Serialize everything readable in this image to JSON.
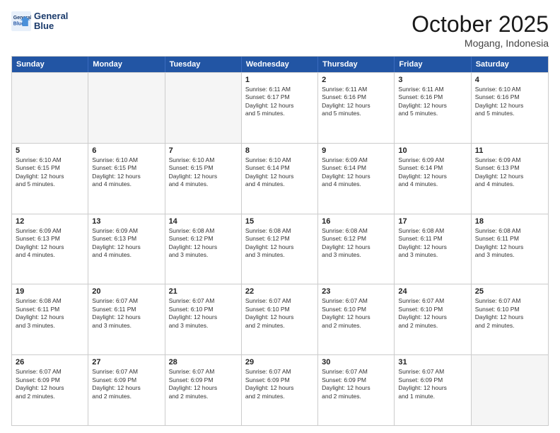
{
  "header": {
    "logo_line1": "General",
    "logo_line2": "Blue",
    "month": "October 2025",
    "location": "Mogang, Indonesia"
  },
  "days_of_week": [
    "Sunday",
    "Monday",
    "Tuesday",
    "Wednesday",
    "Thursday",
    "Friday",
    "Saturday"
  ],
  "rows": [
    [
      {
        "day": "",
        "info": ""
      },
      {
        "day": "",
        "info": ""
      },
      {
        "day": "",
        "info": ""
      },
      {
        "day": "1",
        "info": "Sunrise: 6:11 AM\nSunset: 6:17 PM\nDaylight: 12 hours\nand 5 minutes."
      },
      {
        "day": "2",
        "info": "Sunrise: 6:11 AM\nSunset: 6:16 PM\nDaylight: 12 hours\nand 5 minutes."
      },
      {
        "day": "3",
        "info": "Sunrise: 6:11 AM\nSunset: 6:16 PM\nDaylight: 12 hours\nand 5 minutes."
      },
      {
        "day": "4",
        "info": "Sunrise: 6:10 AM\nSunset: 6:16 PM\nDaylight: 12 hours\nand 5 minutes."
      }
    ],
    [
      {
        "day": "5",
        "info": "Sunrise: 6:10 AM\nSunset: 6:15 PM\nDaylight: 12 hours\nand 5 minutes."
      },
      {
        "day": "6",
        "info": "Sunrise: 6:10 AM\nSunset: 6:15 PM\nDaylight: 12 hours\nand 4 minutes."
      },
      {
        "day": "7",
        "info": "Sunrise: 6:10 AM\nSunset: 6:15 PM\nDaylight: 12 hours\nand 4 minutes."
      },
      {
        "day": "8",
        "info": "Sunrise: 6:10 AM\nSunset: 6:14 PM\nDaylight: 12 hours\nand 4 minutes."
      },
      {
        "day": "9",
        "info": "Sunrise: 6:09 AM\nSunset: 6:14 PM\nDaylight: 12 hours\nand 4 minutes."
      },
      {
        "day": "10",
        "info": "Sunrise: 6:09 AM\nSunset: 6:14 PM\nDaylight: 12 hours\nand 4 minutes."
      },
      {
        "day": "11",
        "info": "Sunrise: 6:09 AM\nSunset: 6:13 PM\nDaylight: 12 hours\nand 4 minutes."
      }
    ],
    [
      {
        "day": "12",
        "info": "Sunrise: 6:09 AM\nSunset: 6:13 PM\nDaylight: 12 hours\nand 4 minutes."
      },
      {
        "day": "13",
        "info": "Sunrise: 6:09 AM\nSunset: 6:13 PM\nDaylight: 12 hours\nand 4 minutes."
      },
      {
        "day": "14",
        "info": "Sunrise: 6:08 AM\nSunset: 6:12 PM\nDaylight: 12 hours\nand 3 minutes."
      },
      {
        "day": "15",
        "info": "Sunrise: 6:08 AM\nSunset: 6:12 PM\nDaylight: 12 hours\nand 3 minutes."
      },
      {
        "day": "16",
        "info": "Sunrise: 6:08 AM\nSunset: 6:12 PM\nDaylight: 12 hours\nand 3 minutes."
      },
      {
        "day": "17",
        "info": "Sunrise: 6:08 AM\nSunset: 6:11 PM\nDaylight: 12 hours\nand 3 minutes."
      },
      {
        "day": "18",
        "info": "Sunrise: 6:08 AM\nSunset: 6:11 PM\nDaylight: 12 hours\nand 3 minutes."
      }
    ],
    [
      {
        "day": "19",
        "info": "Sunrise: 6:08 AM\nSunset: 6:11 PM\nDaylight: 12 hours\nand 3 minutes."
      },
      {
        "day": "20",
        "info": "Sunrise: 6:07 AM\nSunset: 6:11 PM\nDaylight: 12 hours\nand 3 minutes."
      },
      {
        "day": "21",
        "info": "Sunrise: 6:07 AM\nSunset: 6:10 PM\nDaylight: 12 hours\nand 3 minutes."
      },
      {
        "day": "22",
        "info": "Sunrise: 6:07 AM\nSunset: 6:10 PM\nDaylight: 12 hours\nand 2 minutes."
      },
      {
        "day": "23",
        "info": "Sunrise: 6:07 AM\nSunset: 6:10 PM\nDaylight: 12 hours\nand 2 minutes."
      },
      {
        "day": "24",
        "info": "Sunrise: 6:07 AM\nSunset: 6:10 PM\nDaylight: 12 hours\nand 2 minutes."
      },
      {
        "day": "25",
        "info": "Sunrise: 6:07 AM\nSunset: 6:10 PM\nDaylight: 12 hours\nand 2 minutes."
      }
    ],
    [
      {
        "day": "26",
        "info": "Sunrise: 6:07 AM\nSunset: 6:09 PM\nDaylight: 12 hours\nand 2 minutes."
      },
      {
        "day": "27",
        "info": "Sunrise: 6:07 AM\nSunset: 6:09 PM\nDaylight: 12 hours\nand 2 minutes."
      },
      {
        "day": "28",
        "info": "Sunrise: 6:07 AM\nSunset: 6:09 PM\nDaylight: 12 hours\nand 2 minutes."
      },
      {
        "day": "29",
        "info": "Sunrise: 6:07 AM\nSunset: 6:09 PM\nDaylight: 12 hours\nand 2 minutes."
      },
      {
        "day": "30",
        "info": "Sunrise: 6:07 AM\nSunset: 6:09 PM\nDaylight: 12 hours\nand 2 minutes."
      },
      {
        "day": "31",
        "info": "Sunrise: 6:07 AM\nSunset: 6:09 PM\nDaylight: 12 hours\nand 1 minute."
      },
      {
        "day": "",
        "info": ""
      }
    ]
  ]
}
